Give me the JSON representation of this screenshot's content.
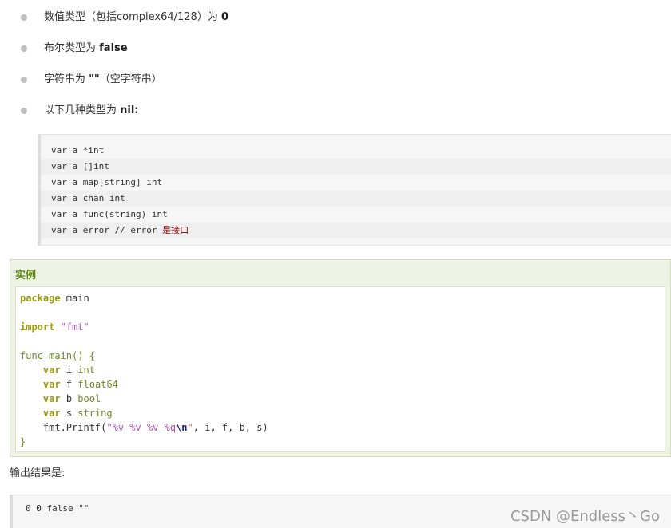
{
  "bullets": [
    {
      "text": "数值类型（包括complex64/128）为 ",
      "bold": "0"
    },
    {
      "text": "布尔类型为 ",
      "bold": "false"
    },
    {
      "text": "字符串为 ",
      "bold": "\"\"",
      "after": "（空字符串）"
    },
    {
      "text": "以下几种类型为 ",
      "bold": "nil:"
    }
  ],
  "nil_code": {
    "lines": [
      "var a *int",
      "var a []int",
      "var a map[string] int",
      "var a chan int",
      "var a func(string) int",
      "var a error // error "
    ],
    "comment_zh": "是接口"
  },
  "example": {
    "title": "实例",
    "lines": [
      {
        "kw": "package",
        "rest": " main"
      },
      {
        "kw": "import",
        "str": " \"fmt\""
      },
      {
        "fn": "func main() {"
      },
      {
        "indent": "    ",
        "kw": "var",
        "name": " i ",
        "type": "int"
      },
      {
        "indent": "    ",
        "kw": "var",
        "name": " f ",
        "type": "float64"
      },
      {
        "indent": "    ",
        "kw": "var",
        "name": " b ",
        "type": "bool"
      },
      {
        "indent": "    ",
        "kw": "var",
        "name": " s ",
        "type": "string"
      },
      {
        "printf_pre": "    fmt.Printf(",
        "printf_str": "\"%v %v %v %q",
        "printf_esc": "\\n",
        "printf_end": "\"",
        "printf_args": ", i, f, b, s)"
      },
      {
        "close": "}"
      }
    ]
  },
  "output": {
    "label": "输出结果是:",
    "value": "0 0 false \"\""
  },
  "watermark": "CSDN @Endless丶Go"
}
